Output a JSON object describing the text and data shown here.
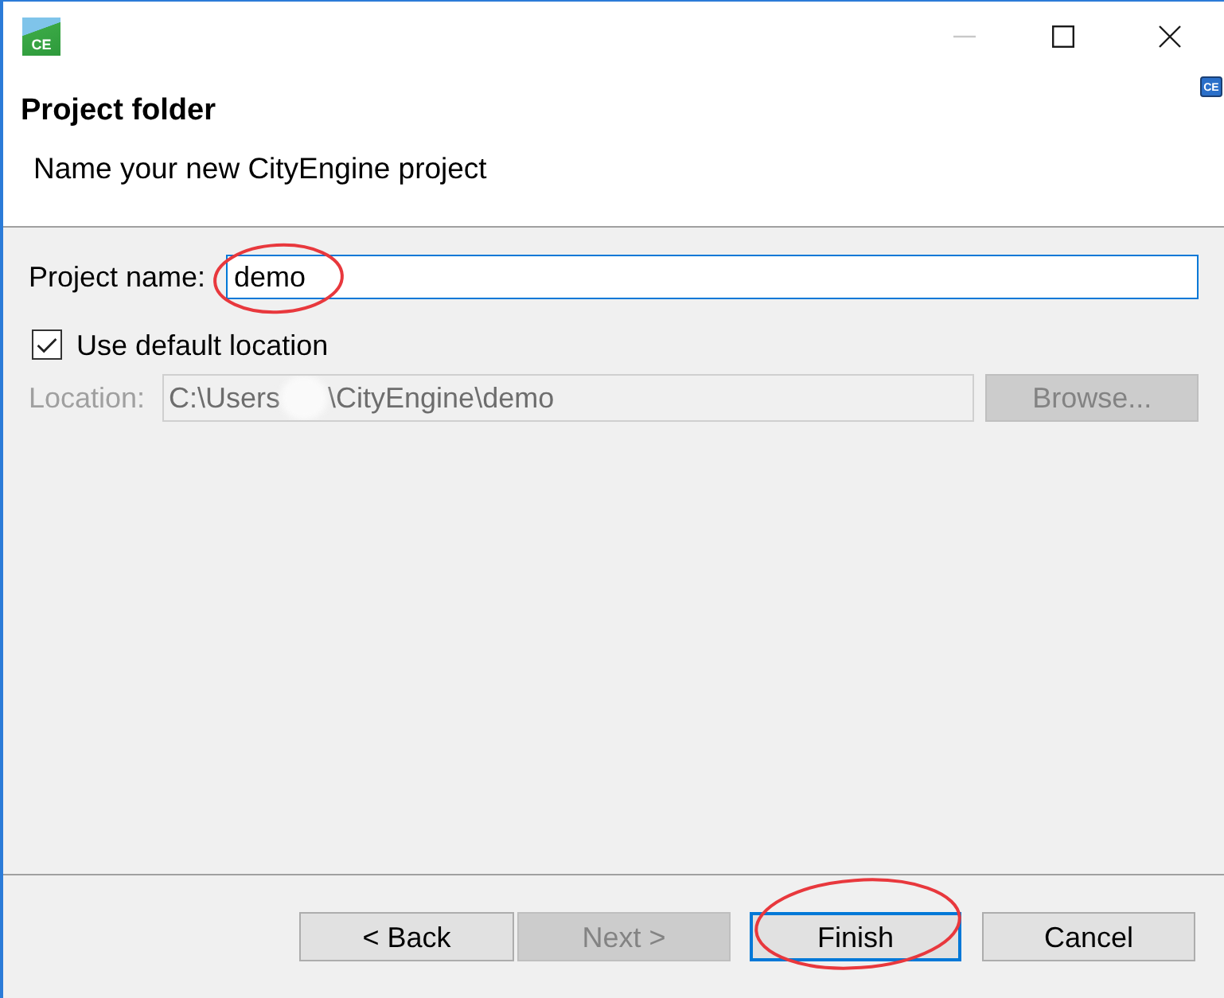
{
  "window": {
    "logo_text": "CE",
    "badge_text": "CE",
    "controls": [
      {
        "kind": "minimize",
        "disabled": true
      },
      {
        "kind": "maximize",
        "disabled": false
      },
      {
        "kind": "close",
        "disabled": false
      }
    ]
  },
  "header": {
    "title": "Project folder",
    "subtitle": "Name your new CityEngine project"
  },
  "form": {
    "project_name": {
      "label": "Project name:",
      "value": "demo",
      "focused": true,
      "circled": true
    },
    "use_default_location": {
      "label": "Use default location",
      "checked": true
    },
    "location": {
      "label": "Location:",
      "value_parts": [
        "C:\\Users",
        "\\CityEngine\\demo"
      ],
      "redacted": true,
      "disabled": true
    },
    "browse_button": {
      "label": "Browse...",
      "disabled": true
    }
  },
  "buttons": [
    {
      "label": "< Back",
      "disabled": false,
      "default": false,
      "circled": false
    },
    {
      "label": "Next >",
      "disabled": true,
      "default": false,
      "circled": false
    },
    {
      "label": "Finish",
      "disabled": false,
      "default": true,
      "circled": true
    },
    {
      "label": "Cancel",
      "disabled": false,
      "default": false,
      "circled": false
    }
  ]
}
